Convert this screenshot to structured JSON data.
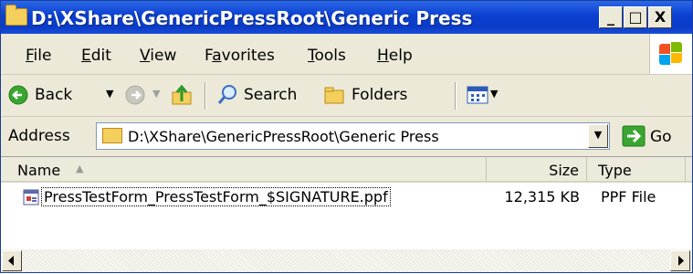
{
  "window": {
    "title": "D:\\XShare\\GenericPressRoot\\Generic Press",
    "controls": {
      "minimize": "_",
      "maximize": "□",
      "close": "X"
    }
  },
  "menubar": {
    "items": [
      {
        "label": "File",
        "mnemonic": "F"
      },
      {
        "label": "Edit",
        "mnemonic": "E"
      },
      {
        "label": "View",
        "mnemonic": "V"
      },
      {
        "label": "Favorites",
        "mnemonic": "a"
      },
      {
        "label": "Tools",
        "mnemonic": "T"
      },
      {
        "label": "Help",
        "mnemonic": "H"
      }
    ]
  },
  "toolbar": {
    "back_label": "Back",
    "search_label": "Search",
    "folders_label": "Folders"
  },
  "addressbar": {
    "label": "Address",
    "value": "D:\\XShare\\GenericPressRoot\\Generic Press",
    "go_label": "Go"
  },
  "filelist": {
    "columns": [
      "Name",
      "Size",
      "Type"
    ],
    "rows": [
      {
        "name": "PressTestForm_PressTestForm_$SIGNATURE.ppf",
        "size": "12,315 KB",
        "type": "PPF File"
      }
    ]
  },
  "colors": {
    "titlebar": "#0a3fd0",
    "chrome": "#ece9d8",
    "go_green": "#3aa632"
  }
}
